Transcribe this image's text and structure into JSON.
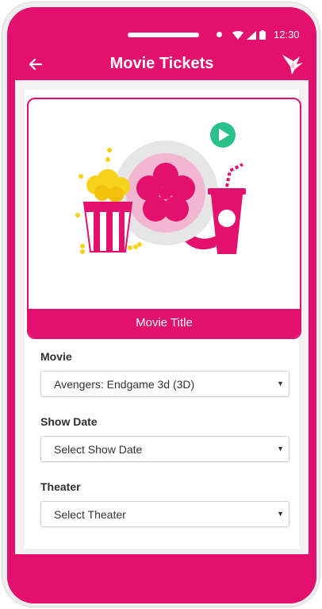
{
  "status_bar": {
    "time": "12:30"
  },
  "app_bar": {
    "title": "Movie Tickets"
  },
  "colors": {
    "accent": "#e3106e",
    "play_button": "#2bc08b",
    "gold": "#f6d21c"
  },
  "icons": {
    "back": "arrow-left-icon",
    "logo": "bird-logo-icon",
    "wifi": "wifi-icon",
    "signal": "signal-icon",
    "battery": "battery-icon",
    "play": "play-icon"
  },
  "media": {
    "caption": "Movie Title"
  },
  "form": {
    "movie": {
      "label": "Movie",
      "value": "Avengers: Endgame 3d (3D)"
    },
    "show_date": {
      "label": "Show Date",
      "value": "Select Show Date"
    },
    "theater": {
      "label": "Theater",
      "value": "Select Theater"
    }
  }
}
